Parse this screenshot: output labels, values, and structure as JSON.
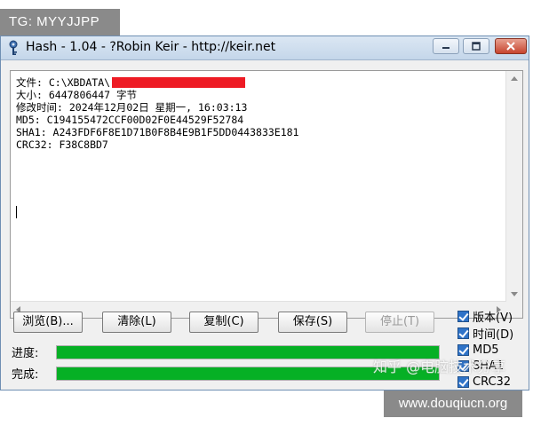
{
  "overlays": {
    "top_tag": "TG: MYYJJPP",
    "mid_watermark": "知乎 @电脑技术分享",
    "bottom_tag": "www.douqiucn.org"
  },
  "window": {
    "title": "Hash - 1.04 - ?Robin Keir - http://keir.net"
  },
  "output": {
    "file_label": "文件: C:\\XBDATA\\",
    "size_line": "大小: 6447806447 字节",
    "modified_line": "修改时间: 2024年12月02日 星期一, 16:03:13",
    "md5_line": "MD5: C194155472CCF00D02F0E44529F52784",
    "sha1_line": "SHA1: A243FDF6F8E1D71B0F8B4E9B1F5DD0443833E181",
    "crc32_line": "CRC32: F38C8BD7"
  },
  "buttons": {
    "browse": "浏览(B)...",
    "clear": "清除(L)",
    "copy": "复制(C)",
    "save": "保存(S)",
    "stop": "停止(T)"
  },
  "progress": {
    "progress_label": "进度:",
    "progress_value": 1.0,
    "done_label": "完成:",
    "done_value": 1.0
  },
  "options": {
    "version": "版本(V)",
    "time": "时间(D)",
    "md5": "MD5",
    "sha1": "SHA1",
    "crc32": "CRC32"
  },
  "colors": {
    "progress_fill": "#06b025",
    "checkbox": "#2f73c8",
    "redaction": "#ee1b24"
  }
}
